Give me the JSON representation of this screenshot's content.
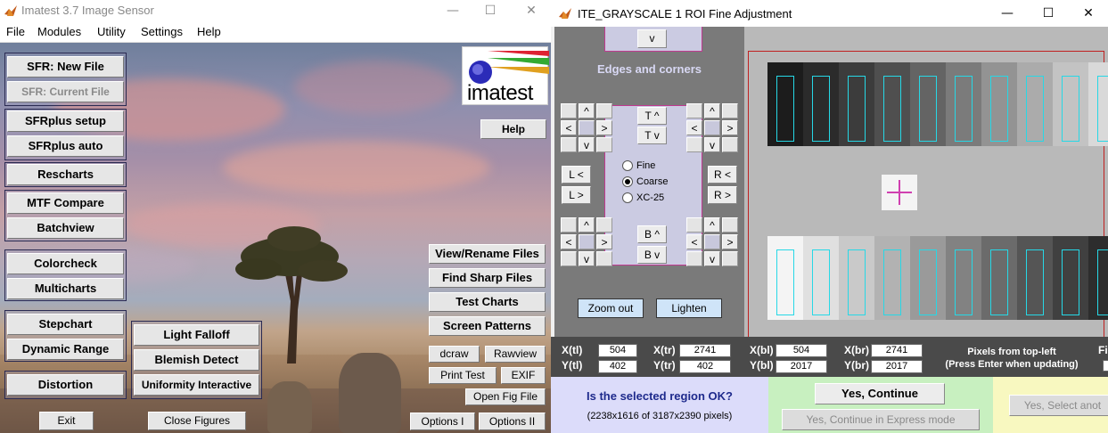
{
  "left_window": {
    "title": "Imatest 3.7   Image Sensor",
    "controls": {
      "minimize": "—",
      "maximize": "☐",
      "close": "✕"
    },
    "menu": [
      "File",
      "Modules",
      "Utility",
      "Settings",
      "Help"
    ],
    "logo_text": "imatest",
    "buttons": {
      "sfr_new_file": "SFR: New File",
      "sfr_current_file": "SFR: Current File",
      "sfrplus_setup": "SFRplus  setup",
      "sfrplus_auto": "SFRplus  auto",
      "rescharts": "Rescharts",
      "mtf_compare": "MTF Compare",
      "batchview": "Batchview",
      "colorcheck": "Colorcheck",
      "multicharts": "Multicharts",
      "stepchart": "Stepchart",
      "dynamic_range": "Dynamic Range",
      "distortion": "Distortion",
      "light_falloff": "Light Falloff",
      "blemish_detect": "Blemish Detect",
      "uniformity_interactive": "Uniformity Interactive",
      "help": "Help",
      "view_rename_files": "View/Rename Files",
      "find_sharp_files": "Find Sharp Files",
      "test_charts": "Test Charts",
      "screen_patterns": "Screen Patterns",
      "dcraw": "dcraw",
      "rawview": "Rawview",
      "print_test": "Print Test",
      "exif": "EXIF",
      "open_fig_file": "Open Fig File",
      "exit": "Exit",
      "close_figures": "Close Figures",
      "options_1": "Options I",
      "options_2": "Options II"
    }
  },
  "right_window": {
    "title": "ITE_GRAYSCALE 1 ROI Fine Adjustment",
    "controls": {
      "minimize": "—",
      "maximize": "☐",
      "close": "✕"
    },
    "panel": {
      "top_v": "v",
      "edges_corners_label": "Edges and corners",
      "up": "^",
      "down": "v",
      "left": "<",
      "right": ">",
      "t_up": "T ^",
      "t_down": "T v",
      "b_up": "B ^",
      "b_down": "B v",
      "l_left": "L <",
      "l_right": "L >",
      "r_left": "R <",
      "r_right": "R >",
      "radio_fine": "Fine",
      "radio_coarse": "Coarse",
      "radio_xc25": "XC-25",
      "selected_mode": "Coarse",
      "zoom_out": "Zoom out",
      "lighten": "Lighten"
    },
    "coords": {
      "labels": [
        "X(tl)",
        "Y(tl)",
        "X(tr)",
        "Y(tr)",
        "X(bl)",
        "Y(bl)",
        "X(br)",
        "Y(br)"
      ],
      "xtl": "504",
      "ytl": "402",
      "xtr": "2741",
      "ytr": "402",
      "xbl": "504",
      "ybl": "2017",
      "xbr": "2741",
      "ybr": "2017",
      "pixels_note_1": "Pixels from top-left",
      "pixels_note_2": "(Press Enter when updating)",
      "cut_label": "Fi"
    },
    "bottom": {
      "question": "Is the selected region OK?",
      "region_info": "(2238x1616 of 3187x2390 pixels)",
      "yes_continue": "Yes, Continue",
      "yes_express": "Yes, Continue in Express mode",
      "yes_select": "Yes, Select anot"
    },
    "colors": {
      "panel_gray": "#7a7a7a",
      "lavender": "#cbcbe2",
      "roi_cyan": "#26d8e6",
      "roi_border_red": "#c02020",
      "center_marker": "#d040b0",
      "coords_bar": "#4a4a4a",
      "bottom_lavender": "#dcdcfa",
      "bottom_green": "#c8f0c0",
      "bottom_yellow": "#f8f8c0"
    },
    "grayscale_patches": {
      "top_row": [
        "#1c1c1c",
        "#2b2b2b",
        "#3c3c3c",
        "#4f4f4f",
        "#646464",
        "#7b7b7b",
        "#939393",
        "#ababab",
        "#c3c3c3",
        "#d9d9d9",
        "#ececec"
      ],
      "bottom_row": [
        "#f4f4f4",
        "#e0e0e0",
        "#c9c9c9",
        "#b2b2b2",
        "#9a9a9a",
        "#828282",
        "#6b6b6b",
        "#555555",
        "#404040",
        "#2d2d2d",
        "#1c1c1c"
      ]
    }
  }
}
